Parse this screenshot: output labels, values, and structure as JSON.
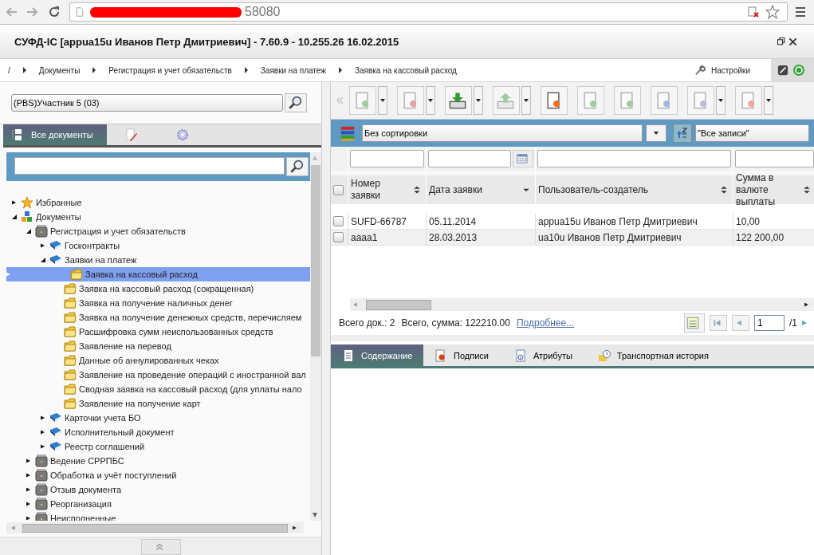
{
  "browser": {
    "url": "58080",
    "redacted": true
  },
  "window": {
    "title": "СУФД-IC [appua15u Иванов Петр Дмитриевич] - 7.60.9 - 10.255.26 16.02.2015"
  },
  "breadcrumbs": [
    "/",
    "Документы",
    "Регистрация и учет обязательств",
    "Заявки на платеж",
    "Заявка на кассовый расход"
  ],
  "settings_label": "Настройки",
  "left_panel": {
    "org_field": {
      "value": "(PBS)Участник 5 (03)"
    },
    "tabs": [
      {
        "kind": "docs",
        "label": "Все документы",
        "selected": true
      },
      {
        "kind": "edit",
        "selected": false
      },
      {
        "kind": "gear",
        "selected": false
      }
    ],
    "tree": [
      {
        "label": "Избранные",
        "kind": "star",
        "expanded": false,
        "selected": false
      },
      {
        "label": "Документы",
        "kind": "cubes",
        "expanded": true,
        "selected": false,
        "children": [
          {
            "label": "Регистрация и учет обязательств",
            "kind": "case",
            "expanded": true,
            "selected": false,
            "children": [
              {
                "label": "Госконтракты",
                "kind": "book",
                "expanded": false,
                "selected": false
              },
              {
                "label": "Заявки на платеж",
                "kind": "book",
                "expanded": true,
                "selected": false,
                "children": [
                  {
                    "label": "Заявка на кассовый расход",
                    "kind": "folder",
                    "selected": true
                  },
                  {
                    "label": "Заявка на кассовый расход (сокращенная)",
                    "kind": "folder",
                    "selected": false
                  },
                  {
                    "label": "Заявка на получение наличных денег",
                    "kind": "folder",
                    "selected": false
                  },
                  {
                    "label": "Заявка на получение денежных средств, перечисляем",
                    "kind": "folder",
                    "selected": false
                  },
                  {
                    "label": "Расшифровка сумм неиспользованных средств",
                    "kind": "folder",
                    "selected": false
                  },
                  {
                    "label": "Заявление на перевод",
                    "kind": "folder",
                    "selected": false
                  },
                  {
                    "label": "Данные об аннулированных чеках",
                    "kind": "folder",
                    "selected": false
                  },
                  {
                    "label": "Заявление на проведение операций с иностранной вал",
                    "kind": "folder",
                    "selected": false
                  },
                  {
                    "label": "Сводная заявка на кассовый расход (для уплаты нало",
                    "kind": "folder",
                    "selected": false
                  },
                  {
                    "label": "Заявление на получение карт",
                    "kind": "folder",
                    "selected": false
                  }
                ]
              },
              {
                "label": "Карточки учета БО",
                "kind": "book",
                "expanded": false,
                "selected": false
              },
              {
                "label": "Исполнительный документ",
                "kind": "book",
                "expanded": false,
                "selected": false
              },
              {
                "label": "Реестр соглашений",
                "kind": "book",
                "expanded": false,
                "selected": false
              }
            ]
          },
          {
            "label": "Ведение СРРПБС",
            "kind": "case",
            "expanded": false,
            "selected": false
          },
          {
            "label": "Обработка и учёт поступлений",
            "kind": "case",
            "expanded": false,
            "selected": false
          },
          {
            "label": "Отзыв документа",
            "kind": "case",
            "expanded": false,
            "selected": false
          },
          {
            "label": "Реорганизация",
            "kind": "case",
            "expanded": false,
            "selected": false
          },
          {
            "label": "Неисполненные",
            "kind": "case",
            "expanded": false,
            "selected": false
          }
        ]
      }
    ]
  },
  "toolbar": [
    {
      "kind": "sign",
      "dropdown": true,
      "disabled": true
    },
    {
      "kind": "unsign",
      "dropdown": true,
      "disabled": true
    },
    {
      "kind": "import",
      "dropdown": true,
      "disabled": false
    },
    {
      "kind": "export",
      "dropdown": true,
      "disabled": true
    },
    {
      "kind": "new",
      "dropdown": false,
      "disabled": false
    },
    {
      "kind": "check",
      "dropdown": false,
      "disabled": true
    },
    {
      "kind": "edit",
      "dropdown": false,
      "disabled": true
    },
    {
      "kind": "view",
      "dropdown": false,
      "disabled": true
    },
    {
      "kind": "copy",
      "dropdown": true,
      "disabled": true
    },
    {
      "kind": "delete",
      "dropdown": true,
      "disabled": true
    }
  ],
  "sort_bar": {
    "sort": "Без сортировки",
    "filter": "\"Все записи\""
  },
  "table": {
    "columns": [
      {
        "label": "Номер заявки",
        "sort_descending": false,
        "kind": "text"
      },
      {
        "label": "Дата заявки",
        "sort_descending": true,
        "kind": "date"
      },
      {
        "label": "Пользователь-создатель",
        "sort_descending": false,
        "kind": "text"
      },
      {
        "label": "Сумма в валюте выплаты",
        "sort_descending": false,
        "kind": "text"
      }
    ],
    "all_checked": false,
    "rows": [
      {
        "checked": false,
        "cells": [
          "SUFD-66787",
          "05.11.2014",
          "appua15u Иванов Петр Дмитриевич",
          "10,00"
        ]
      },
      {
        "checked": false,
        "cells": [
          "aaaa1",
          "28.03.2013",
          "ua10u Иванов Петр Дмитриевич",
          "122 200,00"
        ]
      }
    ]
  },
  "summary": {
    "count": "Всего док.: 2",
    "sum": "Всего, сумма: 122210.00",
    "link": "Подробнее..."
  },
  "pager": {
    "page": "1",
    "total": "/1"
  },
  "bottom_tabs": [
    {
      "label": "Содержание",
      "kind": "doc",
      "selected": true
    },
    {
      "label": "Подписи",
      "kind": "seal",
      "selected": false
    },
    {
      "label": "Атрибуты",
      "kind": "info",
      "selected": false
    },
    {
      "label": "Транспортная история",
      "kind": "clock",
      "selected": false
    }
  ]
}
